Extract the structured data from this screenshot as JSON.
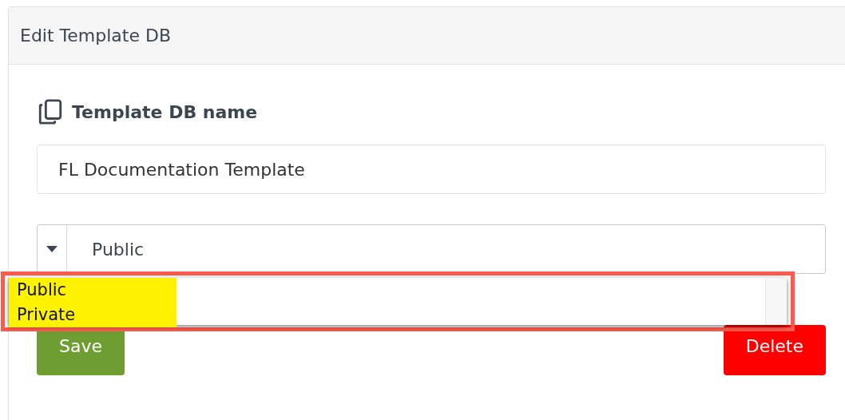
{
  "panel": {
    "title": "Edit Template DB"
  },
  "name_field": {
    "label": "Template DB name",
    "value": "FL Documentation Template"
  },
  "visibility_select": {
    "value": "Public",
    "expanded": true,
    "options": [
      {
        "label": "Public",
        "highlighted": true
      },
      {
        "label": "Private",
        "highlighted": true
      }
    ]
  },
  "buttons": [
    {
      "label": "Save",
      "kind": "save"
    },
    {
      "label": "Delete",
      "kind": "delete"
    }
  ]
}
